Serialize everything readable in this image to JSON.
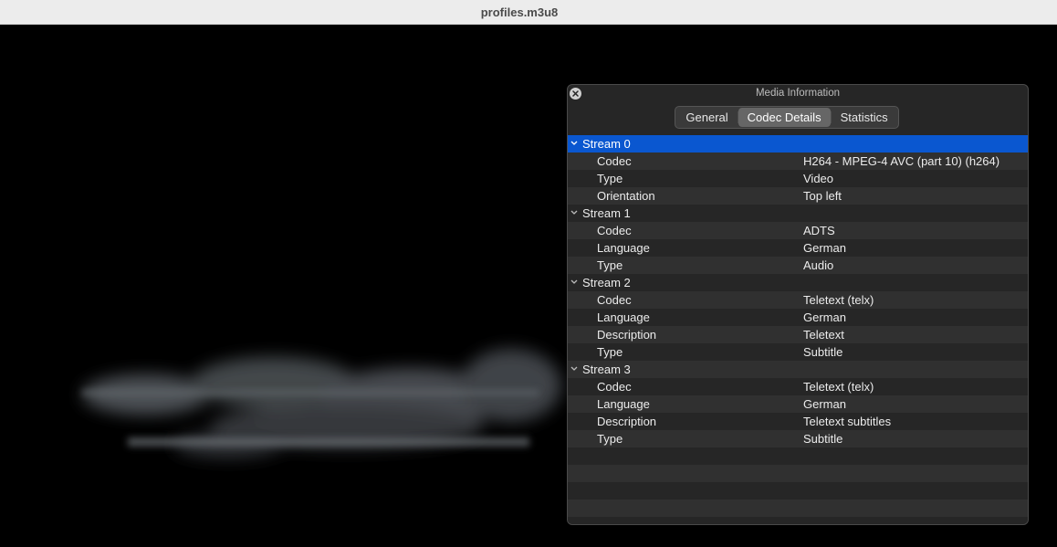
{
  "window": {
    "title": "profiles.m3u8"
  },
  "panel": {
    "title": "Media Information",
    "tabs": [
      {
        "label": "General",
        "active": false
      },
      {
        "label": "Codec Details",
        "active": true
      },
      {
        "label": "Statistics",
        "active": false
      }
    ]
  },
  "streams": [
    {
      "label": "Stream 0",
      "selected": true,
      "properties": [
        {
          "name": "Codec",
          "value": "H264 - MPEG-4 AVC (part 10) (h264)"
        },
        {
          "name": "Type",
          "value": "Video"
        },
        {
          "name": "Orientation",
          "value": "Top left"
        }
      ]
    },
    {
      "label": "Stream 1",
      "selected": false,
      "properties": [
        {
          "name": "Codec",
          "value": "ADTS"
        },
        {
          "name": "Language",
          "value": "German"
        },
        {
          "name": "Type",
          "value": "Audio"
        }
      ]
    },
    {
      "label": "Stream 2",
      "selected": false,
      "properties": [
        {
          "name": "Codec",
          "value": "Teletext (telx)"
        },
        {
          "name": "Language",
          "value": "German"
        },
        {
          "name": "Description",
          "value": "Teletext"
        },
        {
          "name": "Type",
          "value": "Subtitle"
        }
      ]
    },
    {
      "label": "Stream 3",
      "selected": false,
      "properties": [
        {
          "name": "Codec",
          "value": "Teletext (telx)"
        },
        {
          "name": "Language",
          "value": "German"
        },
        {
          "name": "Description",
          "value": "Teletext subtitles"
        },
        {
          "name": "Type",
          "value": "Subtitle"
        }
      ]
    }
  ],
  "colors": {
    "selection": "#0a57d0",
    "panel_bg": "#262626",
    "row_alt": "#303030"
  },
  "icons": {
    "close": "close-icon",
    "expand": "chevron-down-icon"
  }
}
